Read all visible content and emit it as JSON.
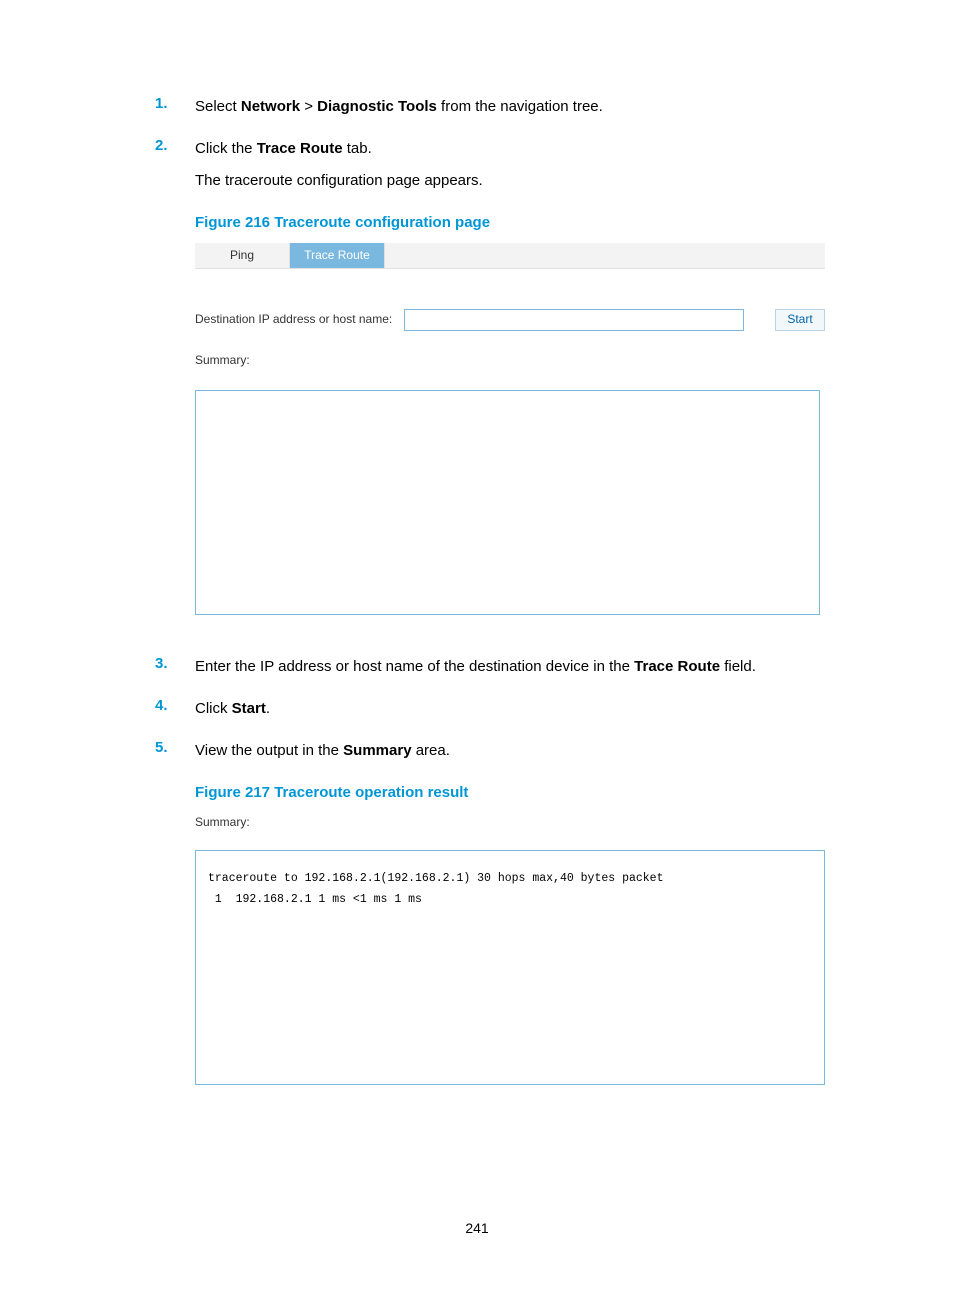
{
  "steps": {
    "s1": {
      "num": "1.",
      "pre": "Select ",
      "b1": "Network",
      "mid": " > ",
      "b2": "Diagnostic Tools",
      "post": " from the navigation tree."
    },
    "s2": {
      "num": "2.",
      "pre": "Click the ",
      "b1": "Trace Route",
      "post": " tab.",
      "note": "The traceroute configuration page appears."
    },
    "s3": {
      "num": "3.",
      "pre": "Enter the IP address or host name of the destination device in the ",
      "b1": "Trace Route",
      "post": " field."
    },
    "s4": {
      "num": "4.",
      "pre": "Click ",
      "b1": "Start",
      "post": "."
    },
    "s5": {
      "num": "5.",
      "pre": "View the output in the ",
      "b1": "Summary",
      "post": " area."
    }
  },
  "figure216": {
    "caption": "Figure 216 Traceroute configuration page",
    "tabs": {
      "ping": "Ping",
      "trace": "Trace Route"
    },
    "dest_label": "Destination IP address or host name:",
    "dest_value": "",
    "start_label": "Start",
    "summary_label": "Summary:"
  },
  "figure217": {
    "caption": "Figure 217 Traceroute operation result",
    "summary_label": "Summary:",
    "output": "traceroute to 192.168.2.1(192.168.2.1) 30 hops max,40 bytes packet\n 1  192.168.2.1 1 ms <1 ms 1 ms"
  },
  "page_number": "241"
}
